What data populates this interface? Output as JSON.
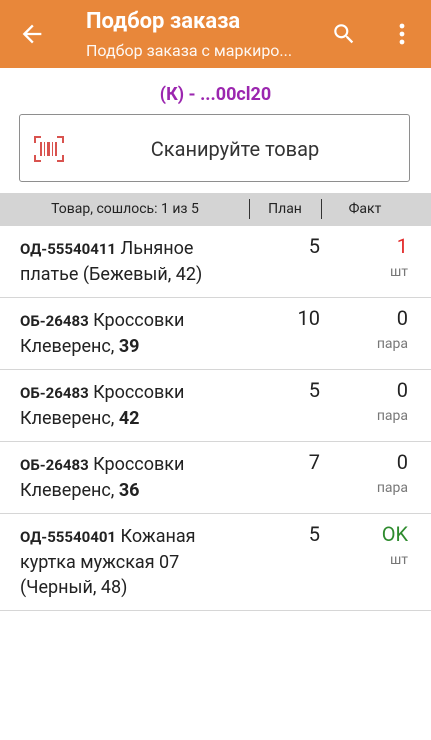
{
  "app": {
    "title": "Подбор заказа",
    "subtitle": "Подбор заказа с маркиро..."
  },
  "order_id": "(К) - ...00cl20",
  "scan": {
    "label": "Сканируйте товар"
  },
  "table": {
    "header_name": "Товар, сошлось: 1 из 5",
    "header_plan": "План",
    "header_fact": "Факт"
  },
  "rows": [
    {
      "code": "ОД-55540411",
      "name_a": " Льняное платье (Бежевый, 42)",
      "name_b": "",
      "plan": "5",
      "fact": "1",
      "fact_color": "#e32b2b",
      "unit": "шт"
    },
    {
      "code": "ОБ-26483",
      "name_a": " Кроссовки Клеверенс, ",
      "name_b": "39",
      "plan": "10",
      "fact": "0",
      "fact_color": "#222222",
      "unit": "пара"
    },
    {
      "code": "ОБ-26483",
      "name_a": " Кроссовки Клеверенс, ",
      "name_b": "42",
      "plan": "5",
      "fact": "0",
      "fact_color": "#222222",
      "unit": "пара"
    },
    {
      "code": "ОБ-26483",
      "name_a": " Кроссовки Клеверенс, ",
      "name_b": "36",
      "plan": "7",
      "fact": "0",
      "fact_color": "#222222",
      "unit": "пара"
    },
    {
      "code": "ОД-55540401",
      "name_a": " Кожаная куртка мужская 07 (Черный, 48)",
      "name_b": "",
      "plan": "5",
      "fact": "OK",
      "fact_color": "#2e8b2e",
      "unit": "шт"
    }
  ],
  "colors": {
    "appbar": "#e8873a",
    "order_id": "#9b26af"
  },
  "icons": [
    "back-arrow-icon",
    "search-icon",
    "more-vert-icon",
    "barcode-icon"
  ]
}
